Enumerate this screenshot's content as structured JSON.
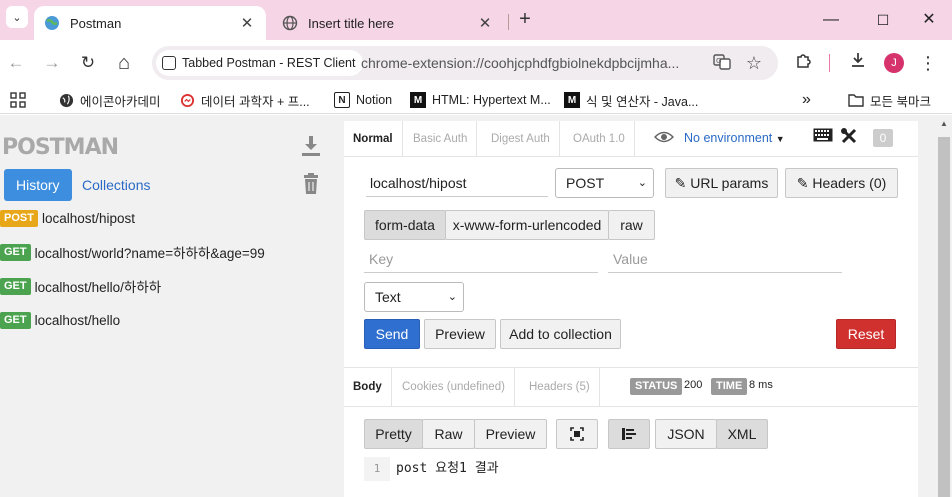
{
  "browser": {
    "tabs": [
      {
        "title": "Postman",
        "favicon": "globe-icon",
        "active": true
      },
      {
        "title": "Insert title here",
        "favicon": "globe-icon",
        "active": false
      }
    ],
    "new_tab": "+",
    "window_controls": {
      "minimize": "—",
      "maximize": "☐",
      "close": "✕"
    },
    "nav": {
      "back": "←",
      "forward": "→",
      "reload": "↻",
      "home": "⌂"
    },
    "address": {
      "chip_label": "Tabbed Postman - REST Client",
      "url": "chrome-extension://coohjcphdfgbiolnekdpbcijmha..."
    },
    "profile_initial": "J",
    "bookmarks": [
      {
        "label": "에이콘아카데미",
        "icon": "globe-icon"
      },
      {
        "label": "데이터 과학자 + 프...",
        "icon": "red-ring-icon"
      },
      {
        "label": "Notion",
        "icon": "notion-icon"
      },
      {
        "label": "HTML: Hypertext M...",
        "icon": "mdn-icon"
      },
      {
        "label": "식 및 연산자 - Java...",
        "icon": "mdn-icon"
      }
    ],
    "bookmarks_overflow": "»",
    "all_bookmarks": "모든 북마크"
  },
  "sidebar": {
    "logo": "POSTMAN",
    "tabs": {
      "history": "History",
      "collections": "Collections"
    },
    "history": [
      {
        "method": "POST",
        "url": "localhost/hipost"
      },
      {
        "method": "GET",
        "url": "localhost/world?name=하하하&age=99"
      },
      {
        "method": "GET",
        "url": "localhost/hello/하하하"
      },
      {
        "method": "GET",
        "url": "localhost/hello"
      }
    ]
  },
  "request": {
    "auth_tabs": [
      "Normal",
      "Basic Auth",
      "Digest Auth",
      "OAuth 1.0"
    ],
    "environment": "No environment",
    "counter": "0",
    "url_value": "localhost/hipost",
    "method": "POST",
    "url_params_label": "URL params",
    "headers_label": "Headers (0)",
    "body_types": [
      "form-data",
      "x-www-form-urlencoded",
      "raw"
    ],
    "key_placeholder": "Key",
    "value_placeholder": "Value",
    "field_type": "Text",
    "send_label": "Send",
    "preview_label": "Preview",
    "add_collection_label": "Add to collection",
    "reset_label": "Reset"
  },
  "response": {
    "tabs": [
      "Body",
      "Cookies (undefined)",
      "Headers (5)"
    ],
    "status_label": "STATUS",
    "status_value": "200",
    "time_label": "TIME",
    "time_value": "8 ms",
    "view_modes": [
      "Pretty",
      "Raw",
      "Preview"
    ],
    "formats": [
      "JSON",
      "XML"
    ],
    "line_number": "1",
    "body_text": "post 요청1 결과"
  }
}
